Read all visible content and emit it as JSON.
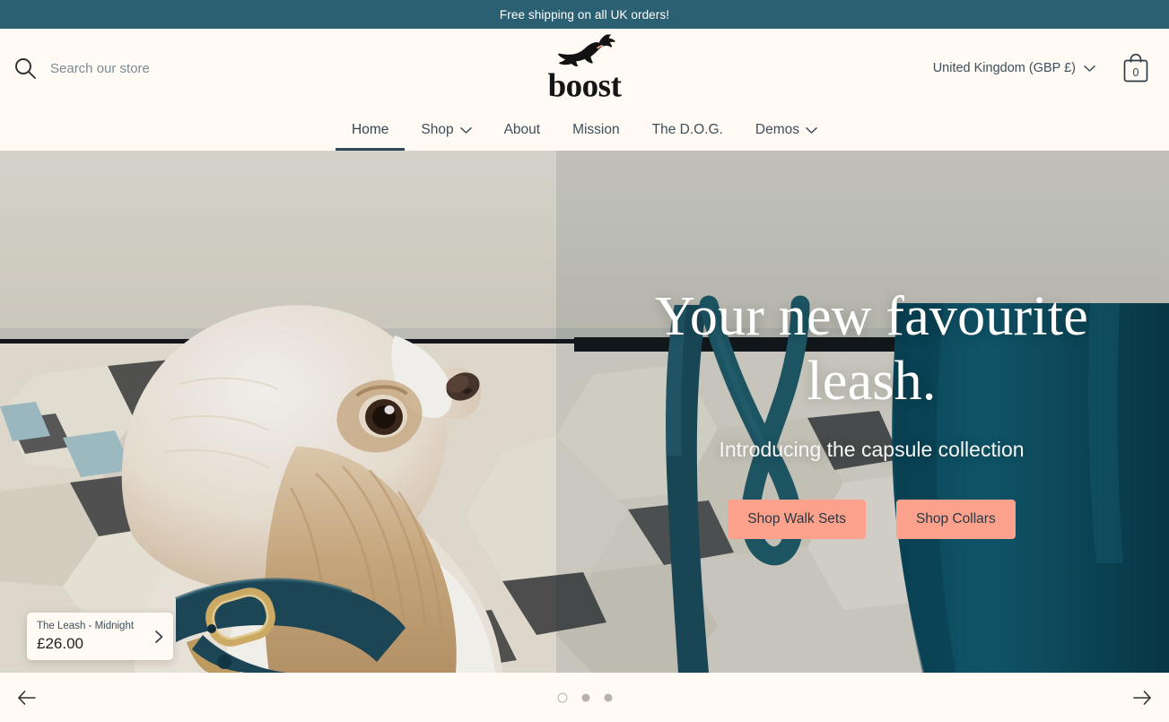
{
  "announcement": {
    "text": "Free shipping on all UK orders!",
    "bg": "#2b6072",
    "color": "#ffffff"
  },
  "header": {
    "search": {
      "icon": "search-icon",
      "placeholder": "Search our store",
      "value": ""
    },
    "brand": {
      "word": "boost",
      "mark": "jumping-dog-icon",
      "collar_color": "#f5a38c"
    },
    "locale": {
      "label": "United Kingdom (GBP £)",
      "chevron": "chevron-down-icon"
    },
    "cart": {
      "icon": "shopping-bag-icon",
      "count": "0"
    }
  },
  "nav": {
    "items": [
      {
        "label": "Home",
        "active": true,
        "caret": false
      },
      {
        "label": "Shop",
        "active": false,
        "caret": true
      },
      {
        "label": "About",
        "active": false,
        "caret": false
      },
      {
        "label": "Mission",
        "active": false,
        "caret": false
      },
      {
        "label": "The D.O.G.",
        "active": false,
        "caret": false
      },
      {
        "label": "Demos",
        "active": false,
        "caret": true
      }
    ],
    "active_underline_color": "#31485a"
  },
  "hero": {
    "title_line1": "Your new favourite",
    "title_line2": "leash.",
    "subtitle": "Introducing the capsule collection",
    "buttons": [
      {
        "label": "Shop Walk Sets"
      },
      {
        "label": "Shop Collars"
      }
    ],
    "button_color": "#fca28c",
    "button_text_color": "#2a3742",
    "product_hotspot": {
      "name": "The Leash - Midnight",
      "price": "£26.00",
      "arrow": "chevron-right-icon"
    }
  },
  "carousel": {
    "prev": {
      "icon": "arrow-left-icon"
    },
    "next": {
      "icon": "arrow-right-icon"
    },
    "dots": [
      {
        "active": true
      },
      {
        "active": false
      },
      {
        "active": false
      }
    ]
  },
  "theme": {
    "page_bg": "#fffaf4",
    "teal": "#2b6072",
    "navy": "#31485a",
    "coral": "#fca28c"
  }
}
